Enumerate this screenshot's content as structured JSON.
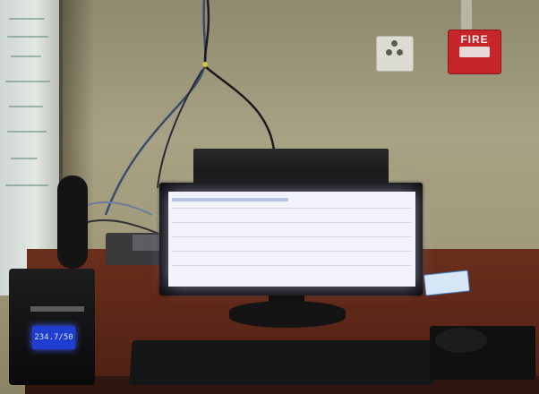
{
  "scene": {
    "description_free": true,
    "fire_alarm_label": "FIRE",
    "ups_display_text": "234.7/50",
    "colors": {
      "fire_alarm": "#c6262a",
      "ups_display": "#1f3dcf",
      "desk": "#6b2e1c",
      "wall": "#a7a283"
    }
  }
}
